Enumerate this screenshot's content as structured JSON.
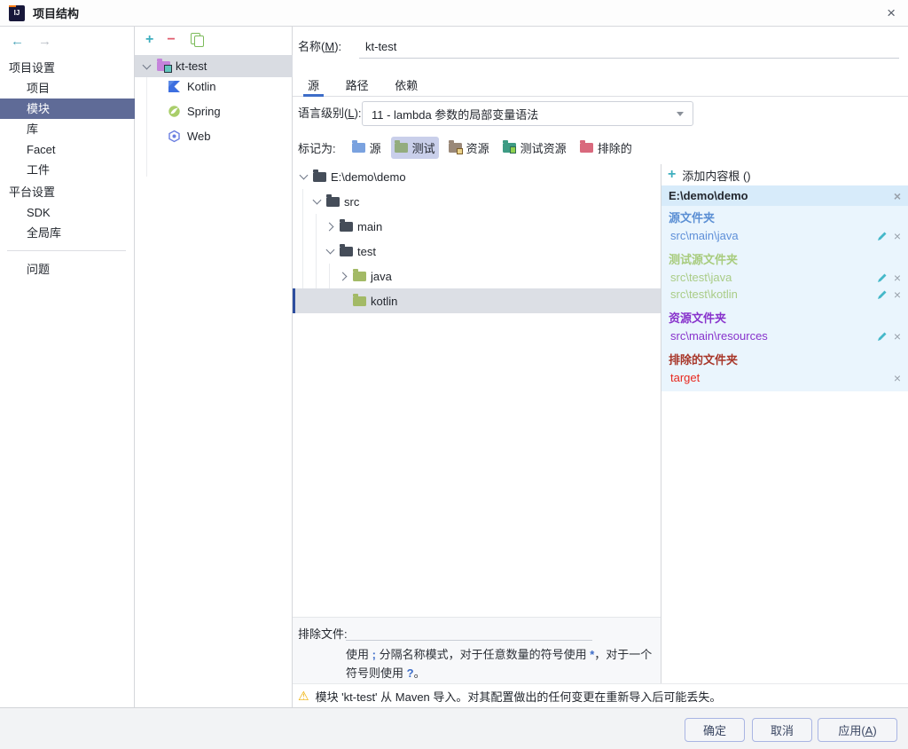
{
  "window": {
    "title": "项目结构",
    "close_icon": "×"
  },
  "sidebar": {
    "project_settings": {
      "label": "项目设置",
      "items": [
        {
          "label": "项目"
        },
        {
          "label": "模块"
        },
        {
          "label": "库"
        },
        {
          "label": "Facet"
        },
        {
          "label": "工件"
        }
      ],
      "selected": "模块"
    },
    "platform_settings": {
      "label": "平台设置",
      "items": [
        {
          "label": "SDK"
        },
        {
          "label": "全局库"
        }
      ]
    },
    "problems_label": "问题"
  },
  "module_list": {
    "root": {
      "label": "kt-test"
    },
    "children": [
      {
        "label": "Kotlin"
      },
      {
        "label": "Spring"
      },
      {
        "label": "Web"
      }
    ]
  },
  "details": {
    "name_label_pre": "名称(",
    "name_mnemonic": "M",
    "name_label_post": "):",
    "name_value": "kt-test",
    "tabs": [
      {
        "label": "源"
      },
      {
        "label": "路径"
      },
      {
        "label": "依赖"
      }
    ],
    "selected_tab": "源",
    "language_level_label_pre": "语言级别(",
    "language_level_mnemonic": "L",
    "language_level_label_post": "):",
    "language_level_value": "11 - lambda 参数的局部变量语法",
    "mark_as_label": "标记为:",
    "mark_items": [
      {
        "label": "源"
      },
      {
        "label": "测试"
      },
      {
        "label": "资源"
      },
      {
        "label": "测试资源"
      },
      {
        "label": "排除的"
      }
    ],
    "mark_selected": "测试",
    "file_tree": [
      {
        "label": "E:\\demo\\demo"
      },
      {
        "label": "src"
      },
      {
        "label": "main"
      },
      {
        "label": "test"
      },
      {
        "label": "java"
      },
      {
        "label": "kotlin"
      }
    ],
    "tree_selected": "kotlin",
    "exclude_files": {
      "label": "排除文件:",
      "value": "",
      "hint": {
        "p1": "使用 ",
        "h1": ";",
        "p2": " 分隔名称模式，对于任意数量的符号使用 ",
        "h2": "*",
        "p3": "，对于一个符号则使用 ",
        "h3": "?",
        "p4": "。"
      }
    }
  },
  "content_roots": {
    "add_label": "添加内容根 ()",
    "root_path": "E:\\demo\\demo",
    "groups": [
      {
        "title": "源文件夹",
        "items": [
          {
            "path": "src\\main\\java"
          }
        ]
      },
      {
        "title": "测试源文件夹",
        "items": [
          {
            "path": "src\\test\\java"
          },
          {
            "path": "src\\test\\kotlin"
          }
        ]
      },
      {
        "title": "资源文件夹",
        "items": [
          {
            "path": "src\\main\\resources"
          }
        ]
      },
      {
        "title": "排除的文件夹",
        "items": [
          {
            "path": "target"
          }
        ]
      }
    ]
  },
  "warning": {
    "text": "模块 'kt-test' 从 Maven 导入。对其配置做出的任何变更在重新导入后可能丢失。"
  },
  "footer": {
    "ok": "确定",
    "cancel": "取消",
    "apply_pre": "应用(",
    "apply_mnemonic": "A",
    "apply_post": ")"
  },
  "colors": {
    "accent_blue": "#3D6DC8",
    "sidebar_selection": "#5F6B97",
    "source_blue": "#5E8FD8",
    "test_green": "#A9CC86",
    "resource_purple": "#8833CC",
    "excluded_red": "#E8281E",
    "warning_yellow": "#EFB000"
  }
}
